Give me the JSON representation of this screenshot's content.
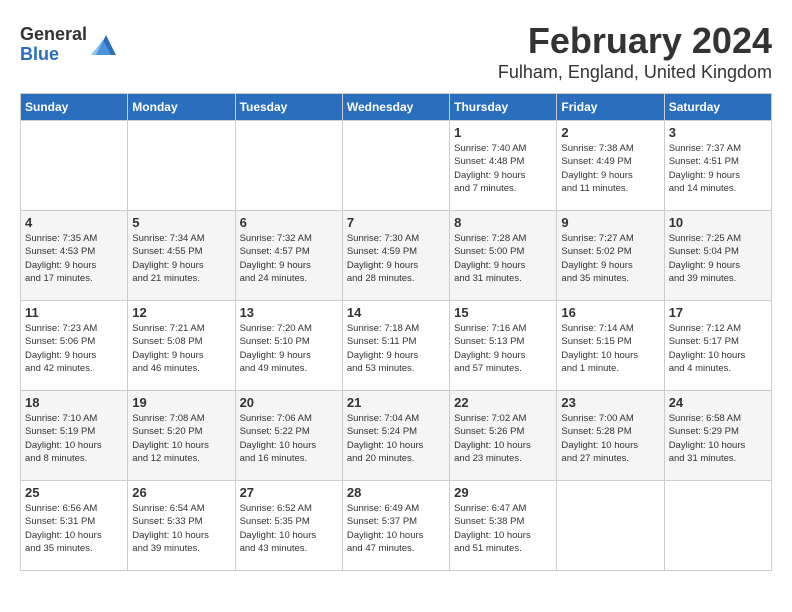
{
  "header": {
    "logo_general": "General",
    "logo_blue": "Blue",
    "month_title": "February 2024",
    "location": "Fulham, England, United Kingdom"
  },
  "weekdays": [
    "Sunday",
    "Monday",
    "Tuesday",
    "Wednesday",
    "Thursday",
    "Friday",
    "Saturday"
  ],
  "weeks": [
    [
      {
        "day": "",
        "info": ""
      },
      {
        "day": "",
        "info": ""
      },
      {
        "day": "",
        "info": ""
      },
      {
        "day": "",
        "info": ""
      },
      {
        "day": "1",
        "info": "Sunrise: 7:40 AM\nSunset: 4:48 PM\nDaylight: 9 hours\nand 7 minutes."
      },
      {
        "day": "2",
        "info": "Sunrise: 7:38 AM\nSunset: 4:49 PM\nDaylight: 9 hours\nand 11 minutes."
      },
      {
        "day": "3",
        "info": "Sunrise: 7:37 AM\nSunset: 4:51 PM\nDaylight: 9 hours\nand 14 minutes."
      }
    ],
    [
      {
        "day": "4",
        "info": "Sunrise: 7:35 AM\nSunset: 4:53 PM\nDaylight: 9 hours\nand 17 minutes."
      },
      {
        "day": "5",
        "info": "Sunrise: 7:34 AM\nSunset: 4:55 PM\nDaylight: 9 hours\nand 21 minutes."
      },
      {
        "day": "6",
        "info": "Sunrise: 7:32 AM\nSunset: 4:57 PM\nDaylight: 9 hours\nand 24 minutes."
      },
      {
        "day": "7",
        "info": "Sunrise: 7:30 AM\nSunset: 4:59 PM\nDaylight: 9 hours\nand 28 minutes."
      },
      {
        "day": "8",
        "info": "Sunrise: 7:28 AM\nSunset: 5:00 PM\nDaylight: 9 hours\nand 31 minutes."
      },
      {
        "day": "9",
        "info": "Sunrise: 7:27 AM\nSunset: 5:02 PM\nDaylight: 9 hours\nand 35 minutes."
      },
      {
        "day": "10",
        "info": "Sunrise: 7:25 AM\nSunset: 5:04 PM\nDaylight: 9 hours\nand 39 minutes."
      }
    ],
    [
      {
        "day": "11",
        "info": "Sunrise: 7:23 AM\nSunset: 5:06 PM\nDaylight: 9 hours\nand 42 minutes."
      },
      {
        "day": "12",
        "info": "Sunrise: 7:21 AM\nSunset: 5:08 PM\nDaylight: 9 hours\nand 46 minutes."
      },
      {
        "day": "13",
        "info": "Sunrise: 7:20 AM\nSunset: 5:10 PM\nDaylight: 9 hours\nand 49 minutes."
      },
      {
        "day": "14",
        "info": "Sunrise: 7:18 AM\nSunset: 5:11 PM\nDaylight: 9 hours\nand 53 minutes."
      },
      {
        "day": "15",
        "info": "Sunrise: 7:16 AM\nSunset: 5:13 PM\nDaylight: 9 hours\nand 57 minutes."
      },
      {
        "day": "16",
        "info": "Sunrise: 7:14 AM\nSunset: 5:15 PM\nDaylight: 10 hours\nand 1 minute."
      },
      {
        "day": "17",
        "info": "Sunrise: 7:12 AM\nSunset: 5:17 PM\nDaylight: 10 hours\nand 4 minutes."
      }
    ],
    [
      {
        "day": "18",
        "info": "Sunrise: 7:10 AM\nSunset: 5:19 PM\nDaylight: 10 hours\nand 8 minutes."
      },
      {
        "day": "19",
        "info": "Sunrise: 7:08 AM\nSunset: 5:20 PM\nDaylight: 10 hours\nand 12 minutes."
      },
      {
        "day": "20",
        "info": "Sunrise: 7:06 AM\nSunset: 5:22 PM\nDaylight: 10 hours\nand 16 minutes."
      },
      {
        "day": "21",
        "info": "Sunrise: 7:04 AM\nSunset: 5:24 PM\nDaylight: 10 hours\nand 20 minutes."
      },
      {
        "day": "22",
        "info": "Sunrise: 7:02 AM\nSunset: 5:26 PM\nDaylight: 10 hours\nand 23 minutes."
      },
      {
        "day": "23",
        "info": "Sunrise: 7:00 AM\nSunset: 5:28 PM\nDaylight: 10 hours\nand 27 minutes."
      },
      {
        "day": "24",
        "info": "Sunrise: 6:58 AM\nSunset: 5:29 PM\nDaylight: 10 hours\nand 31 minutes."
      }
    ],
    [
      {
        "day": "25",
        "info": "Sunrise: 6:56 AM\nSunset: 5:31 PM\nDaylight: 10 hours\nand 35 minutes."
      },
      {
        "day": "26",
        "info": "Sunrise: 6:54 AM\nSunset: 5:33 PM\nDaylight: 10 hours\nand 39 minutes."
      },
      {
        "day": "27",
        "info": "Sunrise: 6:52 AM\nSunset: 5:35 PM\nDaylight: 10 hours\nand 43 minutes."
      },
      {
        "day": "28",
        "info": "Sunrise: 6:49 AM\nSunset: 5:37 PM\nDaylight: 10 hours\nand 47 minutes."
      },
      {
        "day": "29",
        "info": "Sunrise: 6:47 AM\nSunset: 5:38 PM\nDaylight: 10 hours\nand 51 minutes."
      },
      {
        "day": "",
        "info": ""
      },
      {
        "day": "",
        "info": ""
      }
    ]
  ]
}
